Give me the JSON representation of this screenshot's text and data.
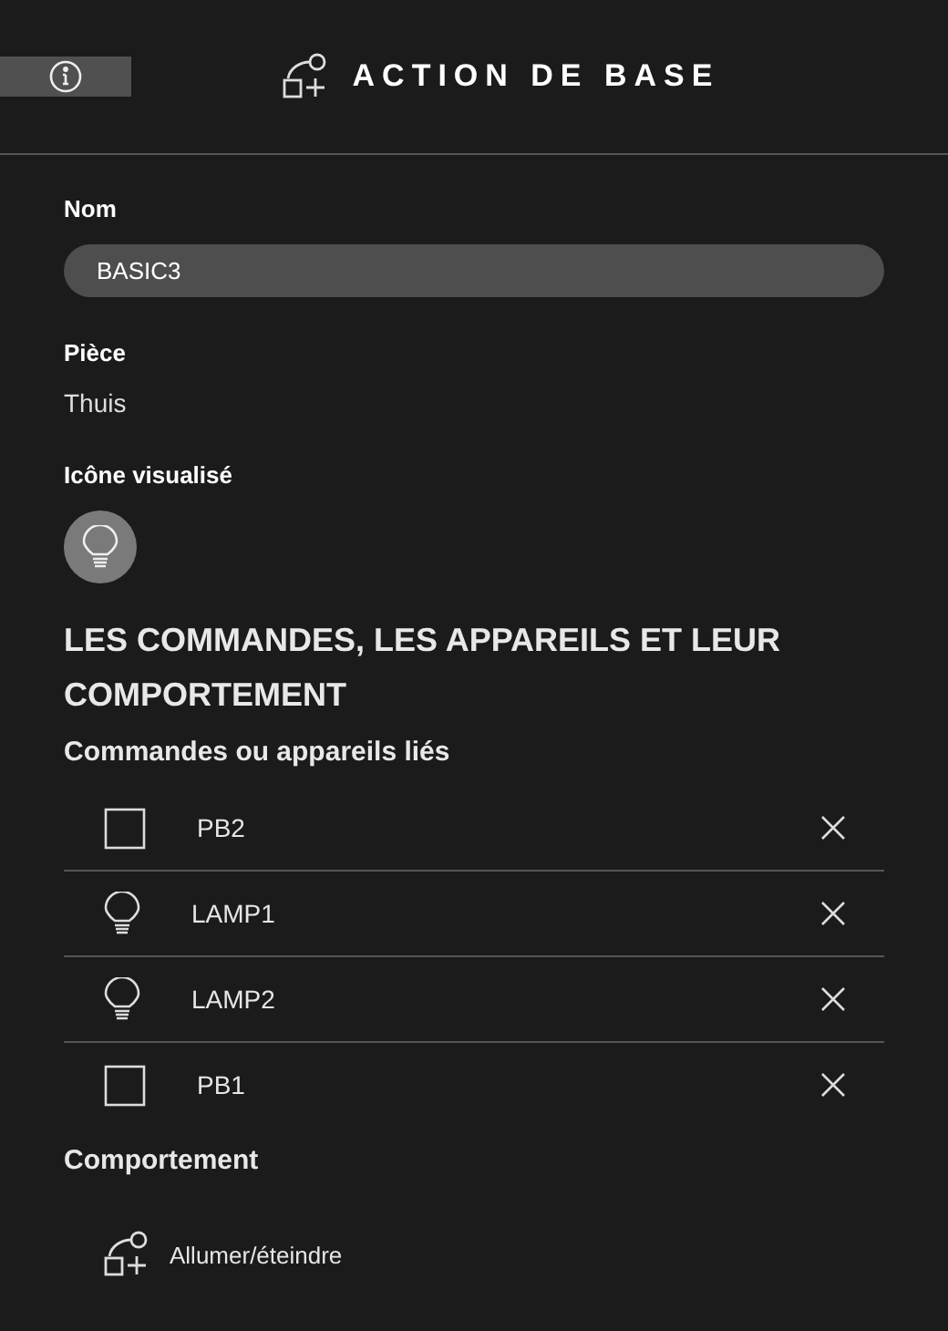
{
  "header": {
    "title": "ACTION DE BASE"
  },
  "fields": {
    "name_label": "Nom",
    "name_value": "BASIC3",
    "room_label": "Pièce",
    "room_value": "Thuis",
    "icon_label": "Icône visualisé"
  },
  "section_title": "LES COMMANDES, LES APPAREILS ET LEUR COMPORTEMENT",
  "linked_title": "Commandes ou appareils liés",
  "linked_items": [
    {
      "kind": "button",
      "name": "PB2"
    },
    {
      "kind": "lamp",
      "name": "LAMP1"
    },
    {
      "kind": "lamp",
      "name": "LAMP2"
    },
    {
      "kind": "button",
      "name": "PB1"
    }
  ],
  "behaviour_title": "Comportement",
  "behaviour": {
    "label": "Allumer/éteindre"
  }
}
